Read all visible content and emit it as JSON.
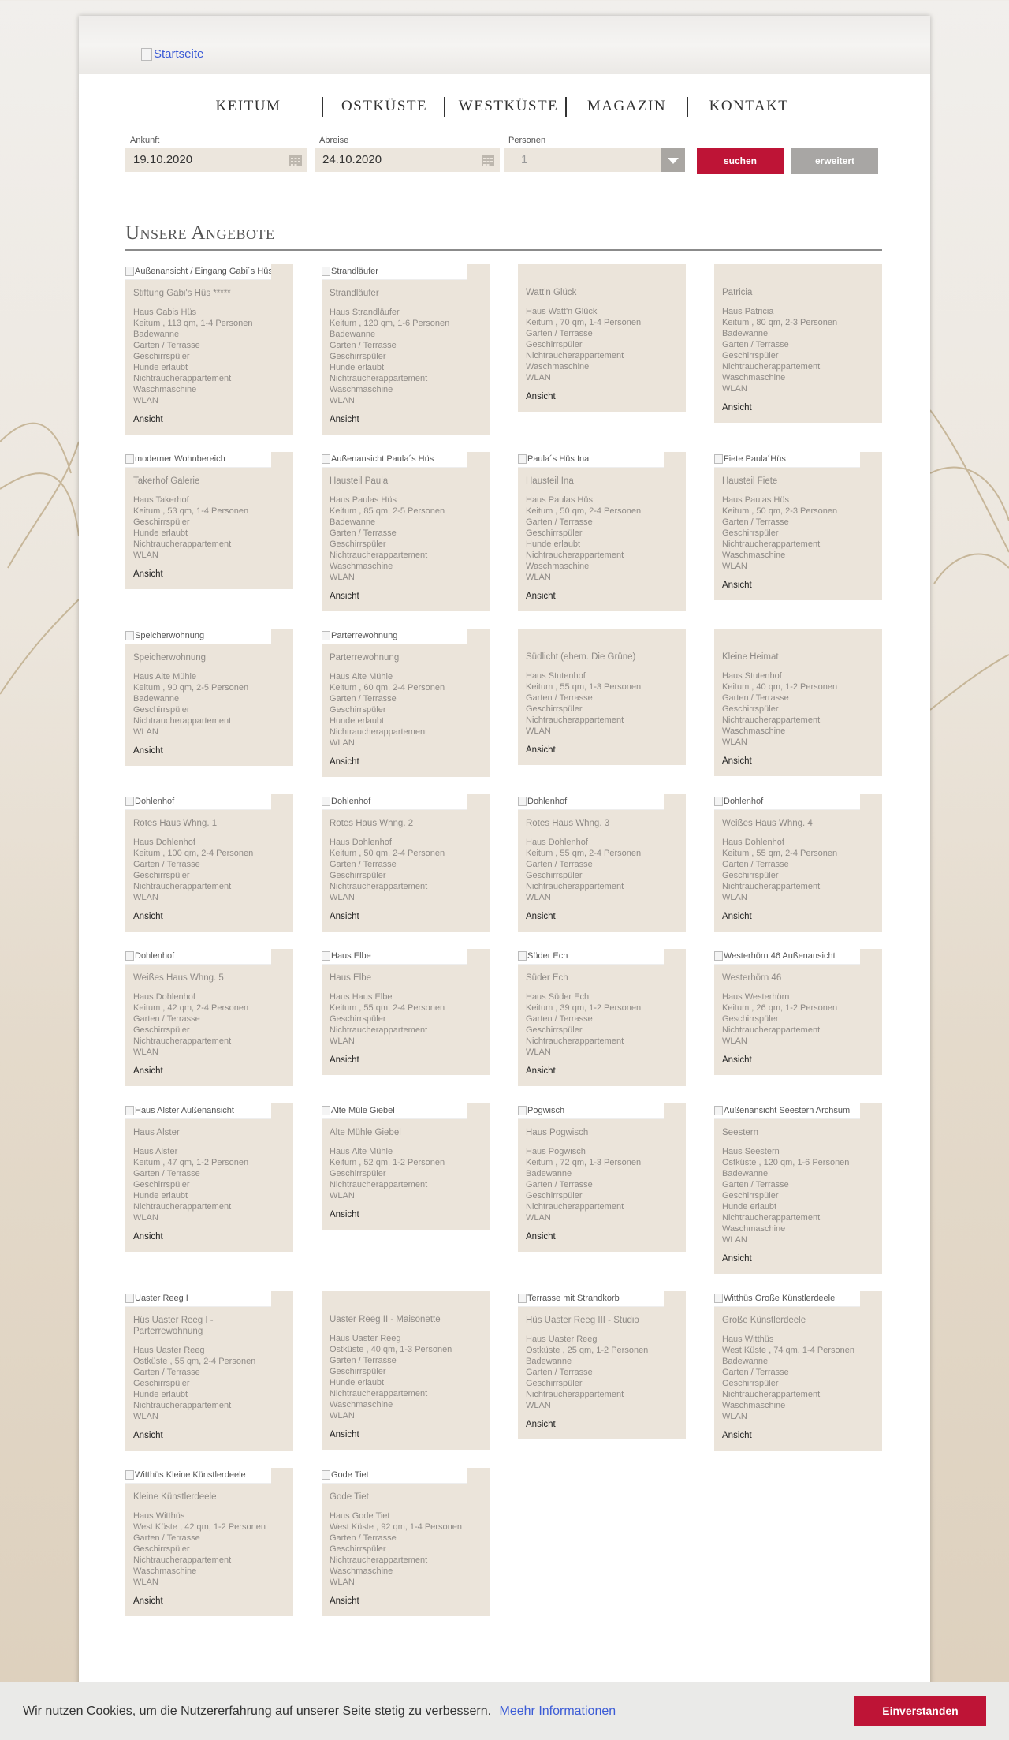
{
  "logo": {
    "alt": "Startseite"
  },
  "nav": {
    "items": [
      "KEITUM",
      "OSTKÜSTE",
      "WESTKÜSTE",
      "MAGAZIN",
      "KONTAKT"
    ]
  },
  "search": {
    "arrival_label": "Ankunft",
    "arrival_value": "19.10.2020",
    "departure_label": "Abreise",
    "departure_value": "24.10.2020",
    "persons_label": "Personen",
    "persons_value": "1",
    "search_button": "suchen",
    "extended_button": "erweitert",
    "search_color": "#be1436",
    "extended_color": "#a8a6a4"
  },
  "section_title": "Unsere Angebote",
  "offers": [
    {
      "img": "Außenansicht / Eingang Gabi´s Hüs",
      "title": "Stiftung Gabi's Hüs *****",
      "house": "Haus Gabis Hüs",
      "details": "Keitum , 113 qm, 1-4 Personen",
      "features": [
        "Badewanne",
        "Garten / Terrasse",
        "Geschirrspüler",
        "Hunde erlaubt",
        "Nichtraucherappartement",
        "Waschmaschine",
        "WLAN"
      ],
      "link": "Ansicht"
    },
    {
      "img": "Strandläufer",
      "title": "Strandläufer",
      "house": "Haus Strandläufer",
      "details": "Keitum , 120 qm, 1-6 Personen",
      "features": [
        "Badewanne",
        "Garten / Terrasse",
        "Geschirrspüler",
        "Hunde erlaubt",
        "Nichtraucherappartement",
        "Waschmaschine",
        "WLAN"
      ],
      "link": "Ansicht"
    },
    {
      "img": "",
      "title": "Watt'n Glück",
      "house": "Haus Watt'n Glück",
      "details": "Keitum , 70 qm, 1-4 Personen",
      "features": [
        "Garten / Terrasse",
        "Geschirrspüler",
        "Nichtraucherappartement",
        "Waschmaschine",
        "WLAN"
      ],
      "link": "Ansicht"
    },
    {
      "img": "",
      "title": "Patricia",
      "house": "Haus Patricia",
      "details": "Keitum , 80 qm, 2-3 Personen",
      "features": [
        "Badewanne",
        "Garten / Terrasse",
        "Geschirrspüler",
        "Nichtraucherappartement",
        "Waschmaschine",
        "WLAN"
      ],
      "link": "Ansicht"
    },
    {
      "img": "moderner Wohnbereich",
      "title": "Takerhof Galerie",
      "house": "Haus Takerhof",
      "details": "Keitum , 53 qm, 1-4 Personen",
      "features": [
        "Geschirrspüler",
        "Hunde erlaubt",
        "Nichtraucherappartement",
        "WLAN"
      ],
      "link": "Ansicht"
    },
    {
      "img": "Außenansicht Paula´s Hüs",
      "title": "Hausteil Paula",
      "house": "Haus Paulas Hüs",
      "details": "Keitum , 85 qm, 2-5 Personen",
      "features": [
        "Badewanne",
        "Garten / Terrasse",
        "Geschirrspüler",
        "Nichtraucherappartement",
        "Waschmaschine",
        "WLAN"
      ],
      "link": "Ansicht"
    },
    {
      "img": "Paula´s Hüs Ina",
      "title": "Hausteil Ina",
      "house": "Haus Paulas Hüs",
      "details": "Keitum , 50 qm, 2-4 Personen",
      "features": [
        "Garten / Terrasse",
        "Geschirrspüler",
        "Hunde erlaubt",
        "Nichtraucherappartement",
        "Waschmaschine",
        "WLAN"
      ],
      "link": "Ansicht"
    },
    {
      "img": "Fiete Paula´Hüs",
      "title": "Hausteil Fiete",
      "house": "Haus Paulas Hüs",
      "details": "Keitum , 50 qm, 2-3 Personen",
      "features": [
        "Garten / Terrasse",
        "Geschirrspüler",
        "Nichtraucherappartement",
        "Waschmaschine",
        "WLAN"
      ],
      "link": "Ansicht"
    },
    {
      "img": "Speicherwohnung",
      "title": "Speicherwohnung",
      "house": "Haus Alte Mühle",
      "details": "Keitum , 90 qm, 2-5 Personen",
      "features": [
        "Badewanne",
        "Geschirrspüler",
        "Nichtraucherappartement",
        "WLAN"
      ],
      "link": "Ansicht"
    },
    {
      "img": "Parterrewohnung",
      "title": "Parterrewohnung",
      "house": "Haus Alte Mühle",
      "details": "Keitum , 60 qm, 2-4 Personen",
      "features": [
        "Garten / Terrasse",
        "Geschirrspüler",
        "Hunde erlaubt",
        "Nichtraucherappartement",
        "WLAN"
      ],
      "link": "Ansicht"
    },
    {
      "img": "",
      "title": "Südlicht (ehem. Die Grüne)",
      "house": "Haus Stutenhof",
      "details": "Keitum , 55 qm, 1-3 Personen",
      "features": [
        "Garten / Terrasse",
        "Geschirrspüler",
        "Nichtraucherappartement",
        "WLAN"
      ],
      "link": "Ansicht"
    },
    {
      "img": "",
      "title": "Kleine Heimat",
      "house": "Haus Stutenhof",
      "details": "Keitum , 40 qm, 1-2 Personen",
      "features": [
        "Garten / Terrasse",
        "Geschirrspüler",
        "Nichtraucherappartement",
        "Waschmaschine",
        "WLAN"
      ],
      "link": "Ansicht"
    },
    {
      "img": "Dohlenhof",
      "title": "Rotes Haus Whng. 1",
      "house": "Haus Dohlenhof",
      "details": "Keitum , 100 qm, 2-4 Personen",
      "features": [
        "Garten / Terrasse",
        "Geschirrspüler",
        "Nichtraucherappartement",
        "WLAN"
      ],
      "link": "Ansicht"
    },
    {
      "img": "Dohlenhof",
      "title": "Rotes Haus Whng. 2",
      "house": "Haus Dohlenhof",
      "details": "Keitum , 50 qm, 2-4 Personen",
      "features": [
        "Garten / Terrasse",
        "Geschirrspüler",
        "Nichtraucherappartement",
        "WLAN"
      ],
      "link": "Ansicht"
    },
    {
      "img": "Dohlenhof",
      "title": "Rotes Haus Whng. 3",
      "house": "Haus Dohlenhof",
      "details": "Keitum , 55 qm, 2-4 Personen",
      "features": [
        "Garten / Terrasse",
        "Geschirrspüler",
        "Nichtraucherappartement",
        "WLAN"
      ],
      "link": "Ansicht"
    },
    {
      "img": "Dohlenhof",
      "title": "Weißes Haus Whng. 4",
      "house": "Haus Dohlenhof",
      "details": "Keitum , 55 qm, 2-4 Personen",
      "features": [
        "Garten / Terrasse",
        "Geschirrspüler",
        "Nichtraucherappartement",
        "WLAN"
      ],
      "link": "Ansicht"
    },
    {
      "img": "Dohlenhof",
      "title": "Weißes Haus Whng. 5",
      "house": "Haus Dohlenhof",
      "details": "Keitum , 42 qm, 2-4 Personen",
      "features": [
        "Garten / Terrasse",
        "Geschirrspüler",
        "Nichtraucherappartement",
        "WLAN"
      ],
      "link": "Ansicht"
    },
    {
      "img": "Haus Elbe",
      "title": "Haus Elbe",
      "house": "Haus Haus Elbe",
      "details": "Keitum , 55 qm, 2-4 Personen",
      "features": [
        "Geschirrspüler",
        "Nichtraucherappartement",
        "WLAN"
      ],
      "link": "Ansicht"
    },
    {
      "img": "Süder Ech",
      "title": "Süder Ech",
      "house": "Haus Süder Ech",
      "details": "Keitum , 39 qm, 1-2 Personen",
      "features": [
        "Garten / Terrasse",
        "Geschirrspüler",
        "Nichtraucherappartement",
        "WLAN"
      ],
      "link": "Ansicht"
    },
    {
      "img": "Westerhörn 46 Außenansicht",
      "title": "Westerhörn 46",
      "house": "Haus Westerhörn",
      "details": "Keitum , 26 qm, 1-2 Personen",
      "features": [
        "Geschirrspüler",
        "Nichtraucherappartement",
        "WLAN"
      ],
      "link": "Ansicht"
    },
    {
      "img": "Haus Alster Außenansicht",
      "title": "Haus Alster",
      "house": "Haus Alster",
      "details": "Keitum , 47 qm, 1-2 Personen",
      "features": [
        "Garten / Terrasse",
        "Geschirrspüler",
        "Hunde erlaubt",
        "Nichtraucherappartement",
        "WLAN"
      ],
      "link": "Ansicht"
    },
    {
      "img": "Alte Müle Giebel",
      "title": "Alte Mühle Giebel",
      "house": "Haus Alte Mühle",
      "details": "Keitum , 52 qm, 1-2 Personen",
      "features": [
        "Geschirrspüler",
        "Nichtraucherappartement",
        "WLAN"
      ],
      "link": "Ansicht"
    },
    {
      "img": "Pogwisch",
      "title": "Haus Pogwisch",
      "house": "Haus Pogwisch",
      "details": "Keitum , 72 qm, 1-3 Personen",
      "features": [
        "Badewanne",
        "Garten / Terrasse",
        "Geschirrspüler",
        "Nichtraucherappartement",
        "WLAN"
      ],
      "link": "Ansicht"
    },
    {
      "img": "Außenansicht Seestern Archsum",
      "title": "Seestern",
      "house": "Haus Seestern",
      "details": "Ostküste , 120 qm, 1-6 Personen",
      "features": [
        "Badewanne",
        "Garten / Terrasse",
        "Geschirrspüler",
        "Hunde erlaubt",
        "Nichtraucherappartement",
        "Waschmaschine",
        "WLAN"
      ],
      "link": "Ansicht"
    },
    {
      "img": "Uaster Reeg I",
      "title": "Hüs Uaster Reeg I - Parterrewohnung",
      "house": "Haus Uaster Reeg",
      "details": "Ostküste , 55 qm, 2-4 Personen",
      "features": [
        "Garten / Terrasse",
        "Geschirrspüler",
        "Hunde erlaubt",
        "Nichtraucherappartement",
        "WLAN"
      ],
      "link": "Ansicht"
    },
    {
      "img": "",
      "title": "Uaster Reeg II - Maisonette",
      "house": "Haus Uaster Reeg",
      "details": "Ostküste , 40 qm, 1-3 Personen",
      "features": [
        "Garten / Terrasse",
        "Geschirrspüler",
        "Hunde erlaubt",
        "Nichtraucherappartement",
        "Waschmaschine",
        "WLAN"
      ],
      "link": "Ansicht"
    },
    {
      "img": "Terrasse mit Strandkorb",
      "title": "Hüs Uaster Reeg III - Studio",
      "house": "Haus Uaster Reeg",
      "details": "Ostküste , 25 qm, 1-2 Personen",
      "features": [
        "Badewanne",
        "Garten / Terrasse",
        "Geschirrspüler",
        "Nichtraucherappartement",
        "WLAN"
      ],
      "link": "Ansicht"
    },
    {
      "img": "Witthüs Große Künstlerdeele",
      "title": "Große Künstlerdeele",
      "house": "Haus Witthüs",
      "details": "West Küste , 74 qm, 1-4 Personen",
      "features": [
        "Badewanne",
        "Garten / Terrasse",
        "Geschirrspüler",
        "Nichtraucherappartement",
        "Waschmaschine",
        "WLAN"
      ],
      "link": "Ansicht"
    },
    {
      "img": "Witthüs Kleine Künstlerdeele",
      "title": "Kleine Künstlerdeele",
      "house": "Haus Witthüs",
      "details": "West Küste , 42 qm, 1-2 Personen",
      "features": [
        "Garten / Terrasse",
        "Geschirrspüler",
        "Nichtraucherappartement",
        "Waschmaschine",
        "WLAN"
      ],
      "link": "Ansicht"
    },
    {
      "img": "Gode Tiet",
      "title": "Gode Tiet",
      "house": "Haus Gode Tiet",
      "details": "West Küste , 92 qm, 1-4 Personen",
      "features": [
        "Garten / Terrasse",
        "Geschirrspüler",
        "Nichtraucherappartement",
        "Waschmaschine",
        "WLAN"
      ],
      "link": "Ansicht"
    }
  ],
  "cookie": {
    "text": "Wir nutzen Cookies, um die Nutzererfahrung auf unserer Seite stetig zu verbessern.",
    "link": "Meehr Informationen",
    "button": "Einverstanden",
    "button_color": "#be1436"
  }
}
